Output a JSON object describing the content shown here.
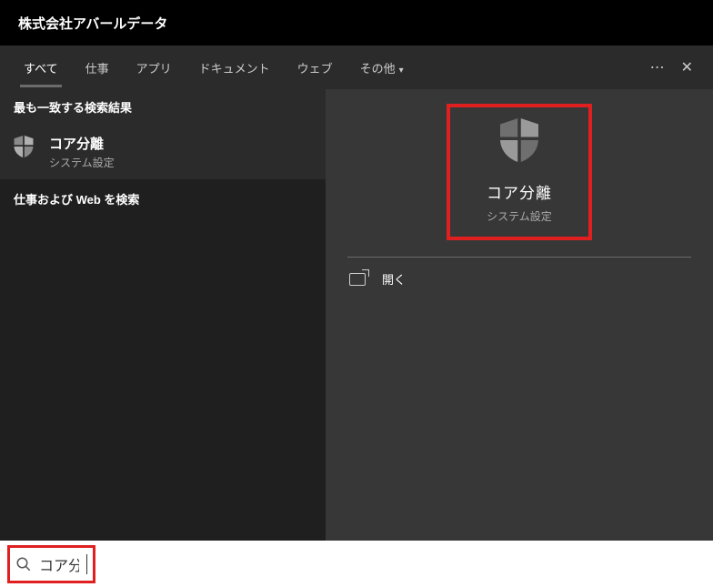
{
  "titlebar": {
    "company": "株式会社アバールデータ"
  },
  "tabs": {
    "all": "すべて",
    "work": "仕事",
    "apps": "アプリ",
    "documents": "ドキュメント",
    "web": "ウェブ",
    "more": "その他"
  },
  "left": {
    "best_match_header": "最も一致する検索結果",
    "result": {
      "title": "コア分離",
      "subtitle": "システム設定"
    },
    "web_header": "仕事および Web を検索"
  },
  "right": {
    "preview": {
      "title": "コア分離",
      "subtitle": "システム設定"
    },
    "open_label": "開く"
  },
  "search": {
    "value": "コア分離"
  }
}
